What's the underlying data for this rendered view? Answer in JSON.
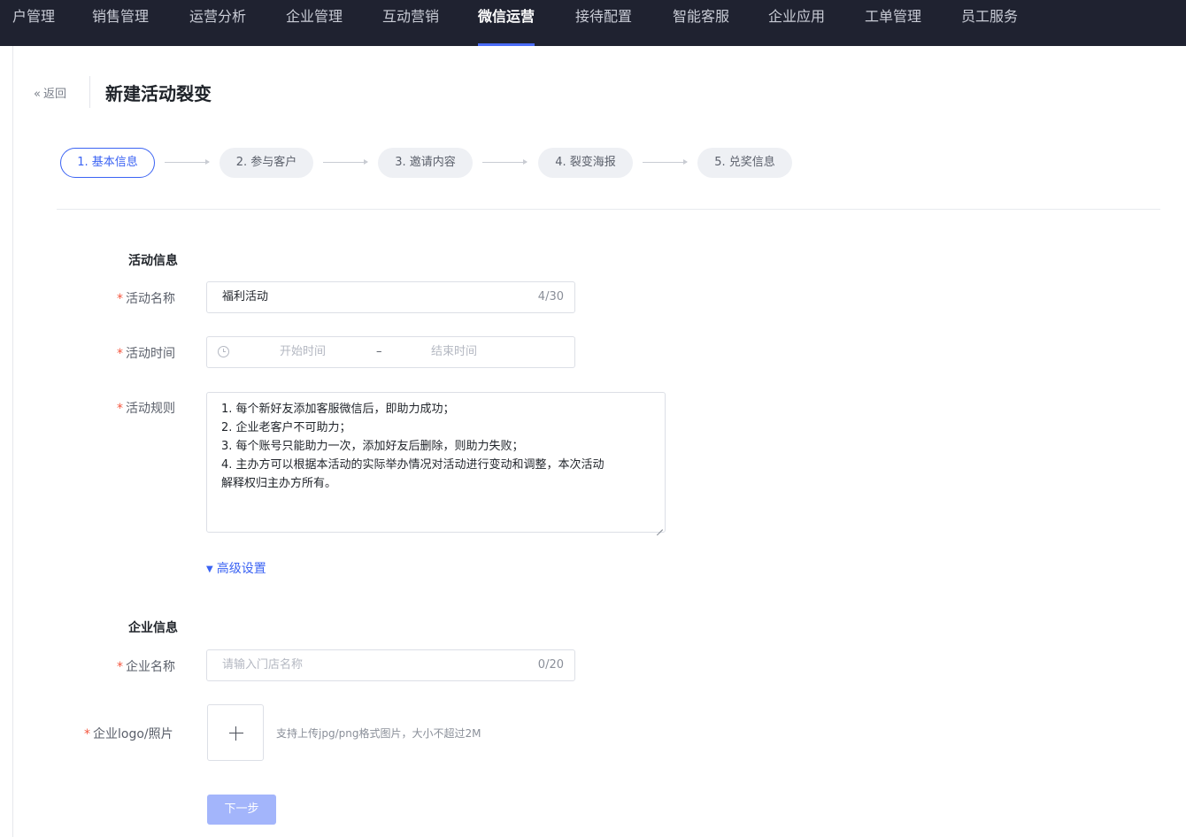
{
  "topnav": {
    "items": [
      {
        "label": "户管理"
      },
      {
        "label": "销售管理"
      },
      {
        "label": "运营分析"
      },
      {
        "label": "企业管理"
      },
      {
        "label": "互动营销"
      },
      {
        "label": "微信运营"
      },
      {
        "label": "接待配置"
      },
      {
        "label": "智能客服"
      },
      {
        "label": "企业应用"
      },
      {
        "label": "工单管理"
      },
      {
        "label": "员工服务"
      }
    ],
    "active": "微信运营"
  },
  "header": {
    "back_label": "返回",
    "back_icon": "double-chevron-left-icon",
    "title": "新建活动裂变"
  },
  "steps": [
    {
      "label": "1. 基本信息",
      "active": true
    },
    {
      "label": "2. 参与客户",
      "active": false
    },
    {
      "label": "3. 邀请内容",
      "active": false
    },
    {
      "label": "4. 裂变海报",
      "active": false
    },
    {
      "label": "5. 兑奖信息",
      "active": false
    }
  ],
  "activity": {
    "section_title": "活动信息",
    "name_label": "活动名称",
    "name_value": "福利活动",
    "name_count": "4/30",
    "time_label": "活动时间",
    "time_start_placeholder": "开始时间",
    "time_separator": "–",
    "time_end_placeholder": "结束时间",
    "rules_label": "活动规则",
    "rules_lines": [
      "1. 每个新好友添加客服微信后，即助力成功；",
      "2. 企业老客户不可助力；",
      "3. 每个账号只能助力一次，添加好友后删除，则助力失败；",
      "4. 主办方可以根据本活动的实际举办情况对活动进行变动和调整，本次活动",
      "解释权归主办方所有。"
    ],
    "advanced_label": "高级设置"
  },
  "company": {
    "section_title": "企业信息",
    "name_label": "企业名称",
    "name_placeholder": "请输入门店名称",
    "name_count": "0/20",
    "logo_label": "企业logo/照片",
    "upload_hint": "支持上传jpg/png格式图片，大小不超过2M"
  },
  "footer": {
    "next_label": "下一步"
  },
  "colors": {
    "nav_bg": "#1f2230",
    "accent": "#3b63f3",
    "required": "#f5563e",
    "button_disabled": "#a3b5fb"
  }
}
